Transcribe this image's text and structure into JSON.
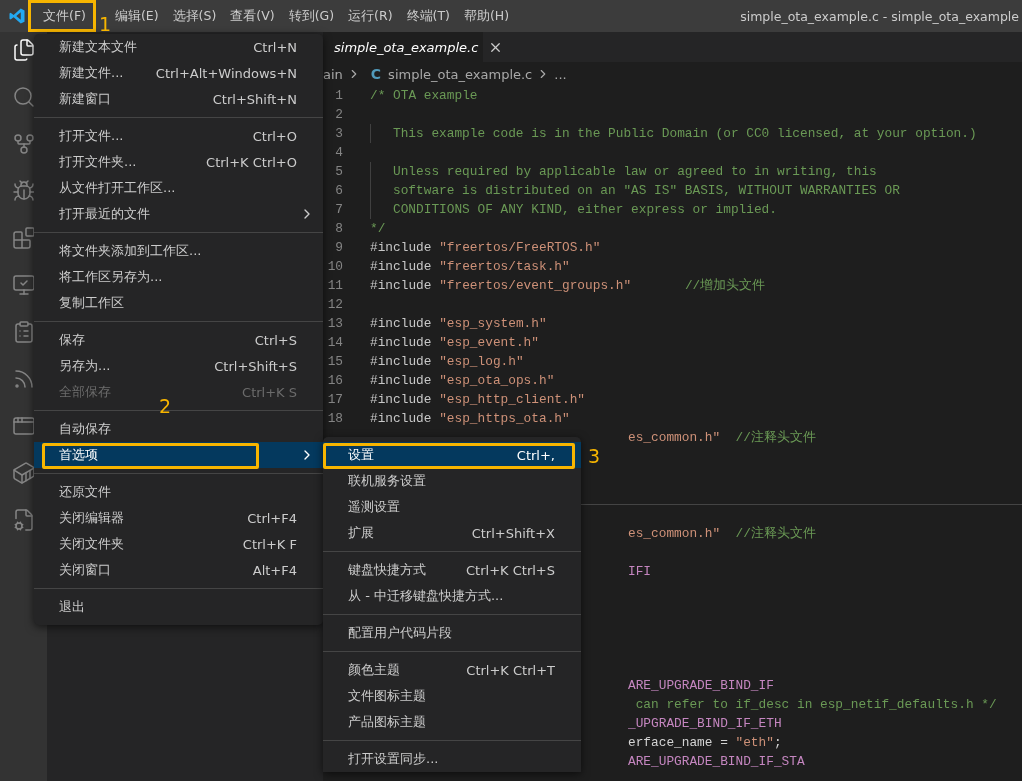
{
  "title_bar": {
    "menus": [
      {
        "label": "文件(F)",
        "outlined": true
      },
      {
        "label": "编辑(E)",
        "outlined": false
      },
      {
        "label": "选择(S)",
        "outlined": false
      },
      {
        "label": "查看(V)",
        "outlined": false
      },
      {
        "label": "转到(G)",
        "outlined": false
      },
      {
        "label": "运行(R)",
        "outlined": false
      },
      {
        "label": "终端(T)",
        "outlined": false
      },
      {
        "label": "帮助(H)",
        "outlined": false
      }
    ],
    "title": "simple_ota_example.c - simple_ota_example"
  },
  "activity_bar": {
    "items": [
      {
        "selected": true
      },
      {
        "selected": false
      },
      {
        "selected": false
      },
      {
        "selected": false
      },
      {
        "selected": false
      },
      {
        "selected": false
      },
      {
        "selected": false
      },
      {
        "selected": false
      },
      {
        "selected": false
      },
      {
        "selected": false
      },
      {
        "selected": false
      }
    ]
  },
  "tabs": [
    {
      "label": "simple_ota_example.c",
      "selected": true
    }
  ],
  "breadcrumb": [
    {
      "label": "ain"
    },
    {
      "label": "simple_ota_example.c",
      "badge": "C"
    },
    {
      "label": "..."
    }
  ],
  "annotations": [
    {
      "text": "1"
    },
    {
      "text": "2"
    },
    {
      "text": "3"
    }
  ],
  "editor": {
    "lines": [
      {
        "number": "1",
        "tokens": [
          {
            "kind": "comment",
            "text": "/* OTA example"
          }
        ]
      },
      {
        "number": "2"
      },
      {
        "number": "3",
        "indent": true,
        "tokens": [
          {
            "kind": "comment",
            "text": "This example code is in the Public Domain (or CC0 licensed, at your option.)"
          }
        ]
      },
      {
        "number": "4"
      },
      {
        "number": "5",
        "indent": true,
        "tokens": [
          {
            "kind": "comment",
            "text": "Unless required by applicable law or agreed to in writing, this"
          }
        ]
      },
      {
        "number": "6",
        "indent": true,
        "tokens": [
          {
            "kind": "comment",
            "text": "software is distributed on an \"AS IS\" BASIS, WITHOUT WARRANTIES OR"
          }
        ]
      },
      {
        "number": "7",
        "indent": true,
        "tokens": [
          {
            "kind": "comment",
            "text": "CONDITIONS OF ANY KIND, either express or implied."
          }
        ]
      },
      {
        "number": "8",
        "tokens": [
          {
            "kind": "comment",
            "text": "*/"
          }
        ]
      },
      {
        "number": "9",
        "tokens": [
          {
            "kind": "directive",
            "text": "#include "
          },
          {
            "kind": "string",
            "text": "\"freertos/FreeRTOS.h\""
          }
        ]
      },
      {
        "number": "10",
        "tokens": [
          {
            "kind": "directive",
            "text": "#include "
          },
          {
            "kind": "string",
            "text": "\"freertos/task.h\""
          }
        ]
      },
      {
        "number": "11",
        "tokens": [
          {
            "kind": "directive",
            "text": "#include "
          },
          {
            "kind": "string",
            "text": "\"freertos/event_groups.h\""
          },
          {
            "kind": "comment",
            "text": "       //增加头文件"
          }
        ]
      },
      {
        "number": "12"
      },
      {
        "number": "13",
        "tokens": [
          {
            "kind": "directive",
            "text": "#include "
          },
          {
            "kind": "string",
            "text": "\"esp_system.h\""
          }
        ]
      },
      {
        "number": "14",
        "tokens": [
          {
            "kind": "directive",
            "text": "#include "
          },
          {
            "kind": "string",
            "text": "\"esp_event.h\""
          }
        ]
      },
      {
        "number": "15",
        "tokens": [
          {
            "kind": "directive",
            "text": "#include "
          },
          {
            "kind": "string",
            "text": "\"esp_log.h\""
          }
        ]
      },
      {
        "number": "16",
        "tokens": [
          {
            "kind": "directive",
            "text": "#include "
          },
          {
            "kind": "string",
            "text": "\"esp_ota_ops.h\""
          }
        ]
      },
      {
        "number": "17",
        "tokens": [
          {
            "kind": "directive",
            "text": "#include "
          },
          {
            "kind": "string",
            "text": "\"esp_http_client.h\""
          }
        ]
      },
      {
        "number": "18",
        "tokens": [
          {
            "kind": "directive",
            "text": "#include "
          },
          {
            "kind": "string",
            "text": "\"esp_https_ota.h\""
          }
        ]
      },
      {
        "partial": true,
        "tokens": [
          {
            "kind": "string",
            "text": "es_common.h\""
          },
          {
            "kind": "comment",
            "text": "  //注释头文件"
          }
        ]
      }
    ],
    "lower_lines": [
      {
        "tokens": [
          {
            "kind": "string",
            "text": "es_common.h\""
          },
          {
            "kind": "comment",
            "text": "  //注释头文件"
          }
        ]
      },
      {
        "tokens": [
          {
            "kind": "macro",
            "text": "IFI"
          }
        ]
      },
      {
        "tokens": [
          {
            "kind": "macro",
            "text": "ARE_UPGRADE_BIND_IF"
          }
        ]
      },
      {
        "tokens": [
          {
            "kind": "comment",
            "text": " can refer to if_desc in esp_netif_defaults.h */"
          }
        ]
      },
      {
        "tokens": [
          {
            "kind": "macro",
            "text": "_UPGRADE_BIND_IF_ETH"
          }
        ]
      },
      {
        "tokens": [
          {
            "kind": "plain",
            "text": "erface_name = "
          },
          {
            "kind": "string",
            "text": "\"eth\""
          },
          {
            "kind": "plain",
            "text": ";"
          }
        ]
      },
      {
        "tokens": [
          {
            "kind": "macro",
            "text": "ARE_UPGRADE_BIND_IF_STA"
          }
        ]
      }
    ]
  },
  "file_menu": {
    "sections": [
      {
        "items": [
          {
            "label": "新建文本文件",
            "shortcut": "Ctrl+N"
          },
          {
            "label": "新建文件...",
            "shortcut": "Ctrl+Alt+Windows+N"
          },
          {
            "label": "新建窗口",
            "shortcut": "Ctrl+Shift+N"
          }
        ]
      },
      {
        "items": [
          {
            "label": "打开文件...",
            "shortcut": "Ctrl+O"
          },
          {
            "label": "打开文件夹...",
            "shortcut": "Ctrl+K Ctrl+O"
          },
          {
            "label": "从文件打开工作区..."
          },
          {
            "label": "打开最近的文件",
            "submenu": true
          }
        ]
      },
      {
        "items": [
          {
            "label": "将文件夹添加到工作区..."
          },
          {
            "label": "将工作区另存为..."
          },
          {
            "label": "复制工作区"
          }
        ]
      },
      {
        "items": [
          {
            "label": "保存",
            "shortcut": "Ctrl+S"
          },
          {
            "label": "另存为...",
            "shortcut": "Ctrl+Shift+S"
          },
          {
            "label": "全部保存",
            "shortcut": "Ctrl+K S",
            "disabled": true
          }
        ]
      },
      {
        "items": [
          {
            "label": "自动保存"
          },
          {
            "label": "首选项",
            "submenu": true,
            "selected": true,
            "outlined": true
          }
        ]
      },
      {
        "items": [
          {
            "label": "还原文件"
          },
          {
            "label": "关闭编辑器",
            "shortcut": "Ctrl+F4"
          },
          {
            "label": "关闭文件夹",
            "shortcut": "Ctrl+K F"
          },
          {
            "label": "关闭窗口",
            "shortcut": "Alt+F4"
          }
        ]
      },
      {
        "items": [
          {
            "label": "退出"
          }
        ]
      }
    ]
  },
  "preferences_menu": {
    "sections": [
      {
        "items": [
          {
            "label": "设置",
            "shortcut": "Ctrl+,",
            "selected": true,
            "outlined": true
          },
          {
            "label": "联机服务设置"
          },
          {
            "label": "遥测设置"
          },
          {
            "label": "扩展",
            "shortcut": "Ctrl+Shift+X"
          }
        ]
      },
      {
        "items": [
          {
            "label": "键盘快捷方式",
            "shortcut": "Ctrl+K Ctrl+S"
          },
          {
            "label": "从 - 中迁移键盘快捷方式..."
          }
        ]
      },
      {
        "items": [
          {
            "label": "配置用户代码片段"
          }
        ]
      },
      {
        "items": [
          {
            "label": "颜色主题",
            "shortcut": "Ctrl+K Ctrl+T"
          },
          {
            "label": "文件图标主题"
          },
          {
            "label": "产品图标主题"
          }
        ]
      },
      {
        "items": [
          {
            "label": "打开设置同步..."
          }
        ]
      }
    ]
  }
}
